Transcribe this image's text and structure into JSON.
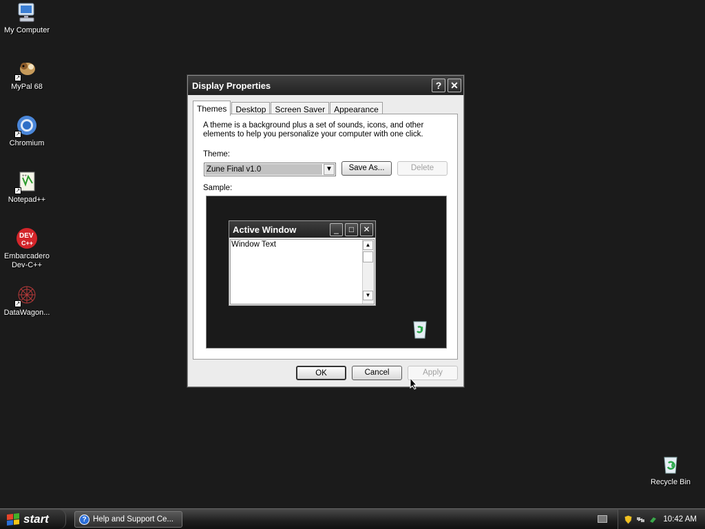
{
  "desktop": {
    "icons": [
      {
        "label": "My Computer",
        "icon": "computer-icon"
      },
      {
        "label": "MyPal 68",
        "icon": "mypal-icon"
      },
      {
        "label": "Chromium",
        "icon": "chromium-icon"
      },
      {
        "label": "Notepad++",
        "icon": "notepadpp-icon"
      },
      {
        "label": "Embarcadero Dev-C++",
        "icon": "devcpp-icon",
        "line1": "Embarcadero",
        "line2": "Dev-C++"
      },
      {
        "label": "DataWagon...",
        "icon": "datawagon-icon"
      }
    ],
    "recycle_bin": {
      "label": "Recycle Bin",
      "icon": "recycle-bin-icon"
    }
  },
  "dialog": {
    "title": "Display Properties",
    "help_button": "?",
    "close_button": "✕",
    "tabs": [
      {
        "label": "Themes",
        "active": true
      },
      {
        "label": "Desktop",
        "active": false
      },
      {
        "label": "Screen Saver",
        "active": false
      },
      {
        "label": "Appearance",
        "active": false
      }
    ],
    "description": "A theme is a background plus a set of sounds, icons, and other elements to help you personalize your computer with one click.",
    "theme_label": "Theme:",
    "theme_value": "Zune Final v1.0",
    "save_as_label": "Save As...",
    "delete_label": "Delete",
    "sample_label": "Sample:",
    "sample": {
      "window_title": "Active Window",
      "window_text": "Window Text"
    },
    "ok_label": "OK",
    "cancel_label": "Cancel",
    "apply_label": "Apply"
  },
  "taskbar": {
    "start_label": "start",
    "task_button": "Help and Support Ce...",
    "clock": "10:42 AM"
  },
  "colors": {
    "desktop_bg": "#1b1b1b",
    "titlebar": "#2e2e2e",
    "help_blue": "#2c6ed8"
  }
}
